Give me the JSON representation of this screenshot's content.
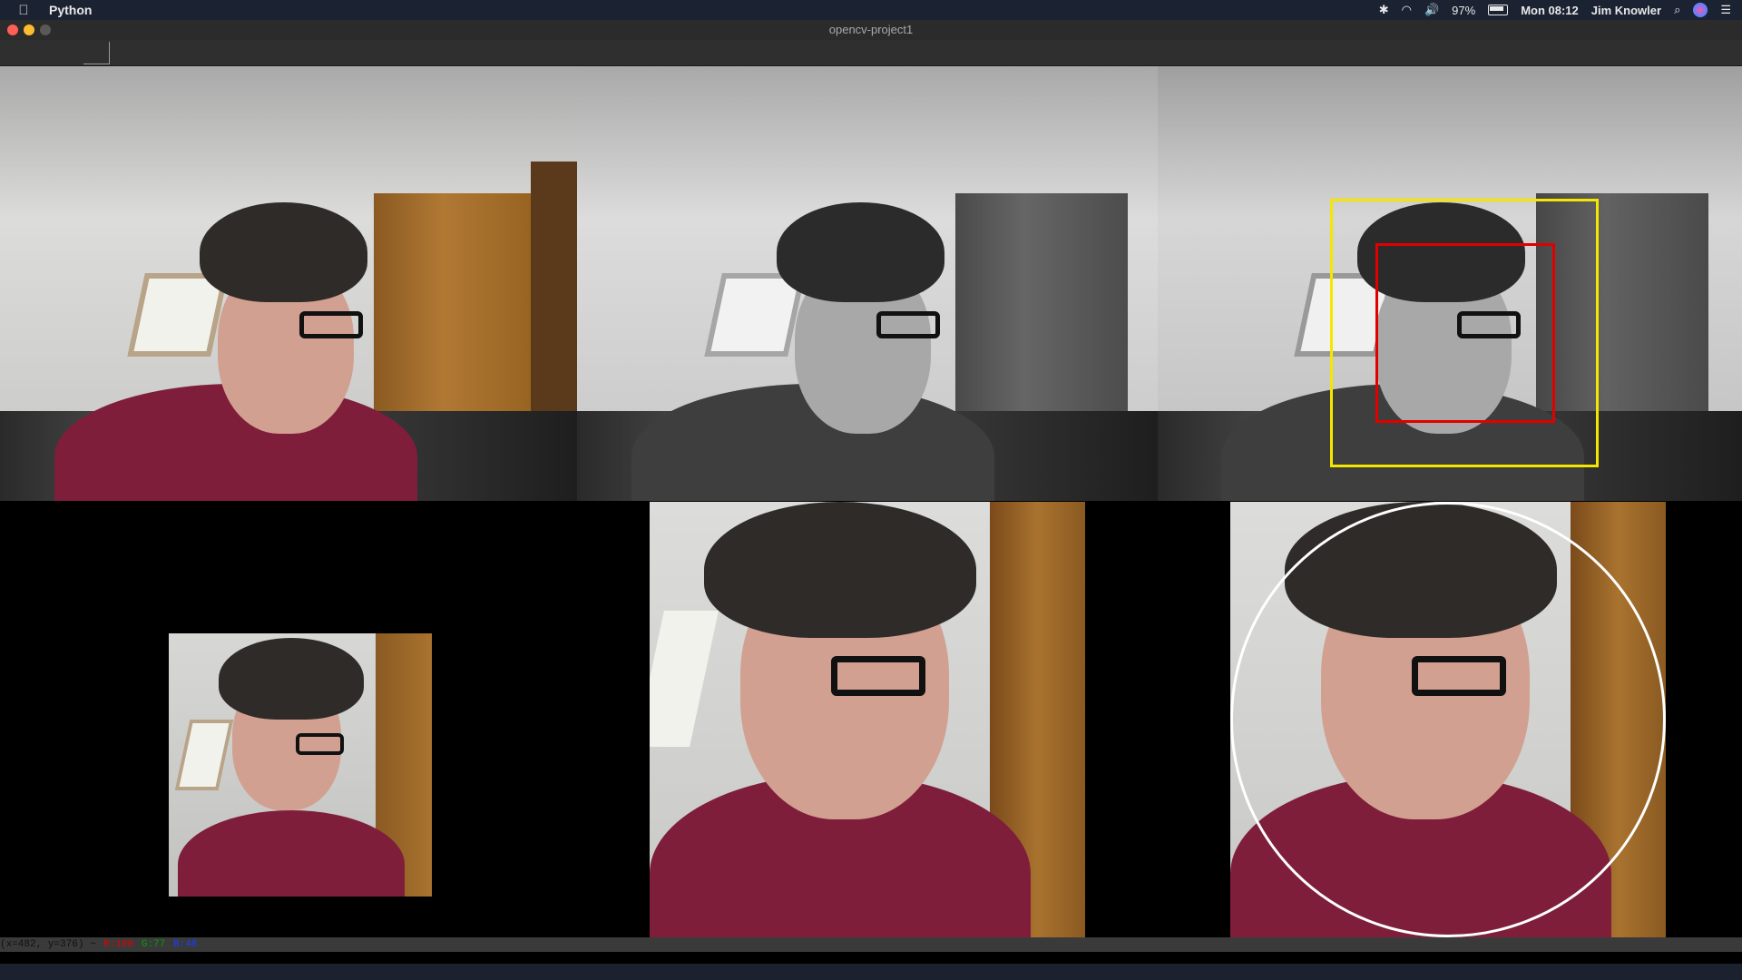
{
  "menubar": {
    "app_name": "Python",
    "battery_pct": "97%",
    "clock": "Mon 08:12",
    "user": "Jim Knowler",
    "icons": [
      "apple-icon",
      "bluetooth-icon",
      "wifi-icon",
      "volume-icon",
      "battery-icon",
      "search-icon",
      "siri-icon",
      "control-center-icon"
    ]
  },
  "window": {
    "title": "opencv-project1"
  },
  "tiles": [
    {
      "name": "original-color-frame",
      "mode": "color"
    },
    {
      "name": "grayscale-frame",
      "mode": "grayscale"
    },
    {
      "name": "detection-frame",
      "mode": "grayscale",
      "overlays": [
        "yellow-rectangle",
        "red-rectangle"
      ],
      "colors": {
        "yellow": "#f5e600",
        "red": "#e00000"
      }
    },
    {
      "name": "cropped-small-frame",
      "mode": "color"
    },
    {
      "name": "zoomed-face-frame",
      "mode": "color"
    },
    {
      "name": "circled-face-frame",
      "mode": "color",
      "overlays": [
        "white-circle"
      ]
    }
  ],
  "status": {
    "coords": "(x=482, y=376) ~",
    "r": "R:100",
    "g": "G:77",
    "b": "B:48"
  }
}
